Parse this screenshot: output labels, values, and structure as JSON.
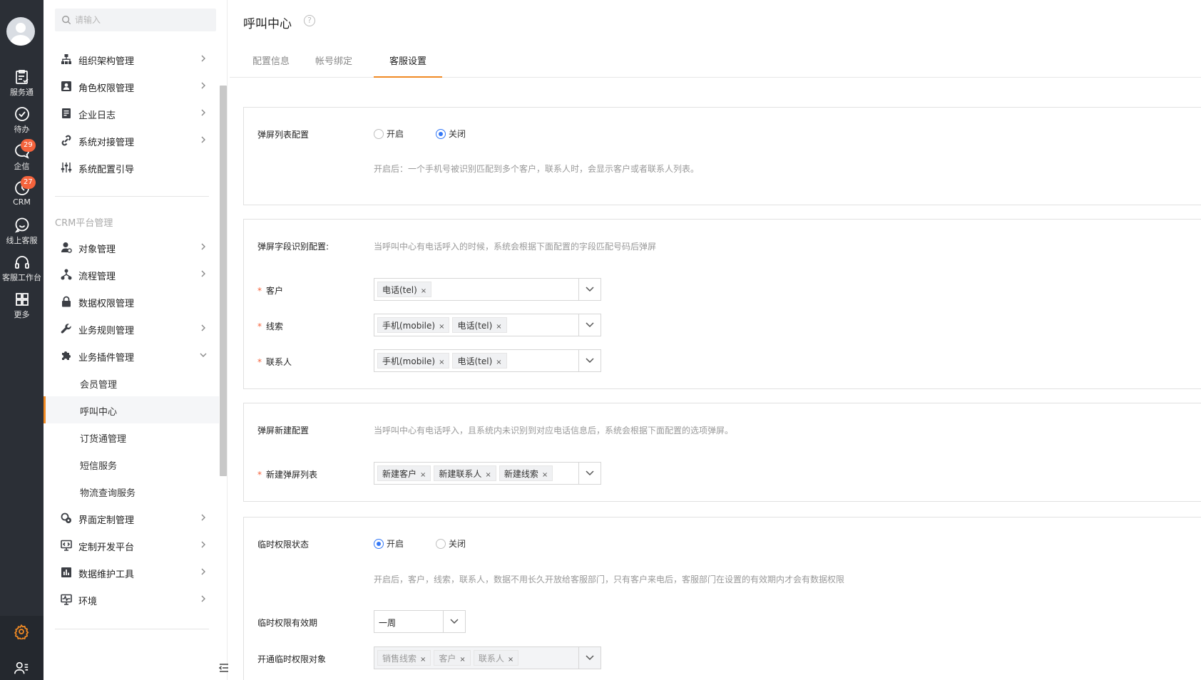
{
  "rail": {
    "items": [
      {
        "label": "服务通",
        "icon": "clipboard-icon"
      },
      {
        "label": "待办",
        "icon": "check-circle-icon"
      },
      {
        "label": "企信",
        "icon": "chat-bubble-icon",
        "badge": "29"
      },
      {
        "label": "CRM",
        "icon": "clock-icon",
        "badge": "27"
      },
      {
        "label": "线上客服",
        "icon": "smile-chat-icon"
      },
      {
        "label": "客服工作台",
        "icon": "headset-icon"
      },
      {
        "label": "更多",
        "icon": "grid-icon"
      }
    ],
    "accent": "#f08a24"
  },
  "sidebar": {
    "search_placeholder": "请输入",
    "items": [
      {
        "label": "组织架构管理",
        "icon": "org-chart-icon"
      },
      {
        "label": "角色权限管理",
        "icon": "user-card-icon"
      },
      {
        "label": "企业日志",
        "icon": "document-icon"
      },
      {
        "label": "系统对接管理",
        "icon": "link-icon"
      },
      {
        "label": "系统配置引导",
        "icon": "sliders-icon"
      }
    ],
    "group_title": "CRM平台管理",
    "crm_items": [
      {
        "label": "对象管理",
        "icon": "object-user-icon"
      },
      {
        "label": "流程管理",
        "icon": "flow-icon"
      },
      {
        "label": "数据权限管理",
        "icon": "lock-icon"
      },
      {
        "label": "业务规则管理",
        "icon": "wrench-icon"
      },
      {
        "label": "业务插件管理",
        "icon": "puzzle-icon"
      }
    ],
    "sub_items": [
      "会员管理",
      "呼叫中心",
      "订货通管理",
      "短信服务",
      "物流查询服务"
    ],
    "bottom_items": [
      {
        "label": "界面定制管理",
        "icon": "customize-icon"
      },
      {
        "label": "定制开发平台",
        "icon": "monitor-code-icon"
      },
      {
        "label": "数据维护工具",
        "icon": "bar-chart-icon"
      },
      {
        "label": "环境",
        "icon": "pulse-icon"
      }
    ]
  },
  "main": {
    "title": "呼叫中心",
    "tabs": [
      "配置信息",
      "帐号绑定",
      "客服设置"
    ],
    "popup_list": {
      "label": "弹屏列表配置",
      "on": "开启",
      "off": "关闭",
      "selected": "关闭",
      "hint": "开启后：一个手机号被识别匹配到多个客户，联系人时，会显示客户或者联系人列表。"
    },
    "field_config": {
      "label": "弹屏字段识别配置:",
      "hint": "当呼叫中心有电话呼入的时候，系统会根据下面配置的字段匹配号码后弹屏",
      "rows": [
        {
          "label": "客户",
          "tags": [
            "电话(tel)"
          ]
        },
        {
          "label": "线索",
          "tags": [
            "手机(mobile)",
            "电话(tel)"
          ]
        },
        {
          "label": "联系人",
          "tags": [
            "手机(mobile)",
            "电话(tel)"
          ]
        }
      ]
    },
    "new_config": {
      "label": "弹屏新建配置",
      "hint": "当呼叫中心有电话呼入，且系统内未识别到对应电话信息后，系统会根据下面配置的选项弹屏。",
      "row_label": "新建弹屏列表",
      "tags": [
        "新建客户",
        "新建联系人",
        "新建线索"
      ]
    },
    "temp_perm": {
      "label": "临时权限状态",
      "on": "开启",
      "off": "关闭",
      "selected": "开启",
      "hint": "开启后，客户，线索，联系人，数据不用长久开放给客服部门，只有客户来电后，客服部门在设置的有效期内才会有数据权限",
      "validity_label": "临时权限有效期",
      "validity_value": "一周",
      "objects_label": "开通临时权限对象",
      "objects_tags": [
        "销售线索",
        "客户",
        "联系人"
      ]
    }
  }
}
